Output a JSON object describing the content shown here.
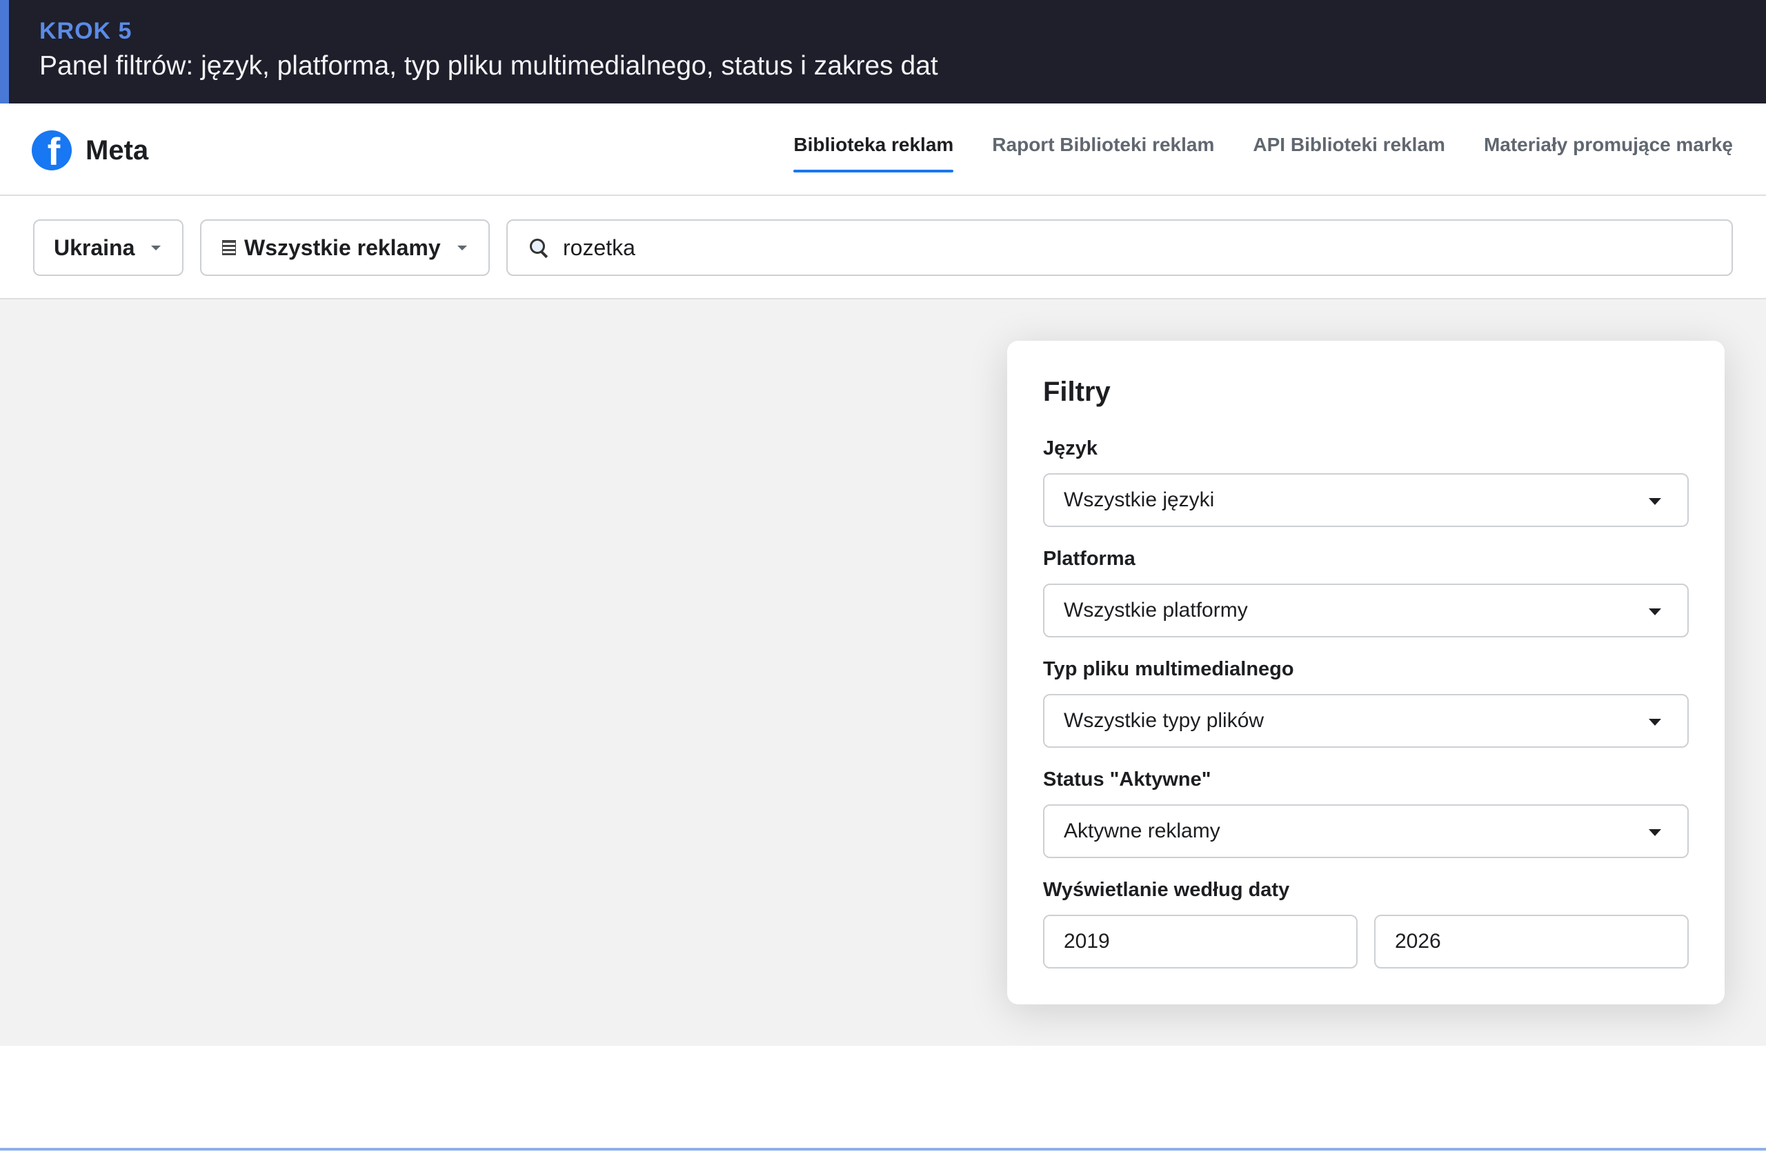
{
  "banner": {
    "step": "KROK 5",
    "description": "Panel filtrów: język, platforma, typ pliku multimedialnego, status i zakres dat"
  },
  "header": {
    "logo_text": "Meta",
    "logo_icon": "facebook-icon",
    "nav": [
      {
        "label": "Biblioteka reklam",
        "active": true
      },
      {
        "label": "Raport Biblioteki reklam",
        "active": false
      },
      {
        "label": "API Biblioteki reklam",
        "active": false
      },
      {
        "label": "Materiały promujące markę",
        "active": false
      }
    ]
  },
  "search_bar": {
    "country": "Ukraina",
    "ad_type": "Wszystkie reklamy",
    "query": "rozetka"
  },
  "filters": {
    "title": "Filtry",
    "language": {
      "label": "Język",
      "value": "Wszystkie języki"
    },
    "platform": {
      "label": "Platforma",
      "value": "Wszystkie platformy"
    },
    "media_type": {
      "label": "Typ pliku multimedialnego",
      "value": "Wszystkie typy plików"
    },
    "status": {
      "label": "Status \"Aktywne\"",
      "value": "Aktywne reklamy"
    },
    "date": {
      "label": "Wyświetlanie według daty",
      "from": "2019",
      "to": "2026"
    }
  },
  "colors": {
    "banner_bg": "#1e1f2b",
    "step_accent": "#5b8be6",
    "brand_blue": "#1877f2",
    "content_bg": "#f2f2f2"
  }
}
